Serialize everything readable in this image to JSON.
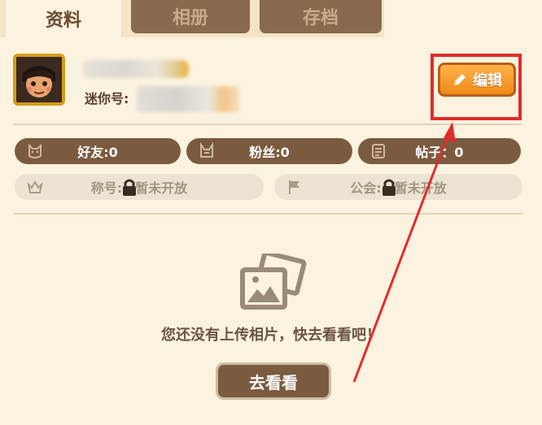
{
  "tabs": [
    {
      "label": "资料",
      "active": true
    },
    {
      "label": "相册",
      "active": false
    },
    {
      "label": "存档",
      "active": false
    }
  ],
  "profile": {
    "mini_id_label": "迷你号:",
    "edit_label": "编辑"
  },
  "stats": {
    "friends": "好友:0",
    "fans": "粉丝:0",
    "posts": "帖子：0"
  },
  "locked": {
    "title": "称号:",
    "title_status": "暂未开放",
    "guild": "公会:",
    "guild_status": "暂未开放"
  },
  "album": {
    "empty_message": "您还没有上传相片，快去看看吧！",
    "go_button": "去看看"
  },
  "colors": {
    "accent": "#f08a18",
    "highlight": "#e22b2b",
    "brown": "#7b5b3f"
  }
}
